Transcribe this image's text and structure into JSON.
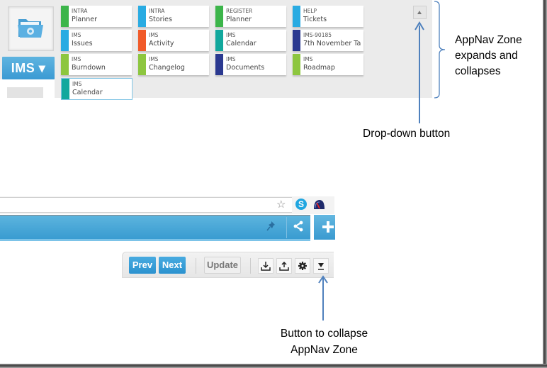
{
  "appnav": {
    "app_button_label": "IMS ▾",
    "logo_icon": "folder-gear-icon",
    "tiles": [
      {
        "category": "INTRA",
        "name": "Planner",
        "color": "#3cb54a"
      },
      {
        "category": "INTRA",
        "name": "Stories",
        "color": "#29abe2"
      },
      {
        "category": "REGISTER",
        "name": "Planner",
        "color": "#3cb54a"
      },
      {
        "category": "HELP",
        "name": "Tickets",
        "color": "#29abe2"
      },
      {
        "category": "IMS",
        "name": "Issues",
        "color": "#29abe2"
      },
      {
        "category": "IMS",
        "name": "Activity",
        "color": "#f15a29"
      },
      {
        "category": "IMS",
        "name": "Calendar",
        "color": "#12a89d"
      },
      {
        "category": "IMS-90185",
        "name": "7th November Ta",
        "color": "#2b3990"
      },
      {
        "category": "IMS",
        "name": "Burndown",
        "color": "#8dc63f"
      },
      {
        "category": "IMS",
        "name": "Changelog",
        "color": "#8dc63f"
      },
      {
        "category": "IMS",
        "name": "Documents",
        "color": "#2b3990"
      },
      {
        "category": "IMS",
        "name": "Roadmap",
        "color": "#8dc63f"
      },
      {
        "category": "IMS",
        "name": "Calendar",
        "color": "#12a89d",
        "selected": true
      }
    ],
    "dropdown_icon": "triangle-up-icon"
  },
  "annotations": {
    "appnav_zone": "AppNav Zone expands and collapses",
    "dropdown_button": "Drop-down button",
    "collapse_button_line1": "Button to collapse",
    "collapse_button_line2": "AppNav Zone"
  },
  "browser": {
    "icons": [
      "star-icon",
      "skype-icon",
      "speedometer-icon"
    ],
    "bar_icons": [
      "pin-icon",
      "share-icon",
      "plus-icon"
    ],
    "accent": "#3a9ad3"
  },
  "toolbar": {
    "prev_label": "Prev",
    "next_label": "Next",
    "update_label": "Update",
    "icon_buttons": [
      "download-icon",
      "upload-icon",
      "gear-icon",
      "collapse-triangle-icon"
    ]
  }
}
